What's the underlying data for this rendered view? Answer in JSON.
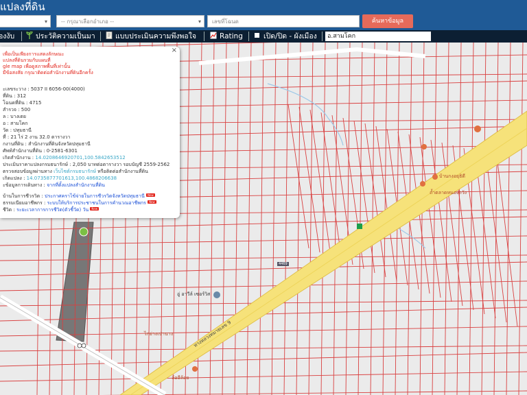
{
  "header": {
    "title": "แปลงที่ดิน",
    "select_district": "",
    "select_subdistrict_placeholder": "-- กรุณาเลือกอำเภอ --",
    "parcel_input_placeholder": "เลขที่โฉนด",
    "search_button": "ค้นหาข้อมูล"
  },
  "toolbar": {
    "items": [
      "องงับ",
      "ประวัติความเป็นมา",
      "แบบประเมินความพึงพอใจ",
      "Rating",
      "เปิด/ปิด - ผังเมือง"
    ],
    "location_value": "อ.สามโคก"
  },
  "popup": {
    "notice_lines": [
      "เพื่อเป็นเพียงการแสดงลักษณะ",
      "แปลงที่ดินรวมกับแผนที่",
      "gle map เพื่อดูสภาพพื้นที่เท่านั้น",
      "มีข้อสงสัย กรุณาติดต่อสำนักงานที่ดินอีกครั้ง"
    ],
    "fields": [
      "ะเลขระวาง : 5037 II 6056-00(4000)",
      "ที่ดิน : 312",
      "โฉนดที่ดิน : 4715",
      "สำรวจ : 500",
      "ล : บางเตย",
      "อ : สามโคก",
      "วัด : ปทุมธานี",
      "ที่ : 21 ไร่ 2 งาน 32.0 ตารางวา",
      "กงานที่ดิน : สำนักงานที่ดินจังหวัดปทุมธานี",
      "ศัพท์สำนักงานที่ดิน : 0-2581-6301"
    ],
    "office_location_label": "เกิดสำนักงาน : ",
    "office_location_value": "14.0208646920701,100.5842653512",
    "appraisal_line_1": "ประเมินราคาแปลงกรมธนารักษ์ : 2,050 บาทต่อตารางวา รอบบัญชี 2559-2562",
    "appraisal_line_2_prefix": "ตรวจสอบข้อมูลผ่านทาง ",
    "appraisal_line_2_link": "เว็บไซต์กรมธนารักษ์",
    "appraisal_line_2_suffix": " หรือติดต่อสำนักงานที่ดิน",
    "parcel_location_label": "เกิดแปลง : ",
    "parcel_location_value": "14.0735877701613,100.4868206638",
    "route_label": "ะข้อมูลการเดินทาง : ",
    "route_link": "จากที่ตั้งแปลงสำนักงานที่ดิน",
    "service_lines": [
      {
        "label": "บ้านในการชีวรวิต : ",
        "link": "ประกาศคราไข้จ่ายในการชีวรวิตจังหวัดปทุมธานี",
        "badge": "New"
      },
      {
        "label": "ธรรมเนียมอาชีพกร : ",
        "link": "ระบบให้บริการประชาชนในการคำนวณอาชีพกร",
        "badge": "New"
      },
      {
        "label": "ชีวิต : ",
        "link": "ระยะเวลาการการชีวิต(ตัวชี้วัด) วัน",
        "badge": "New"
      }
    ]
  },
  "map_labels": {
    "road_number": "ทางหลวงหมายเลข 9",
    "road_badge": "4469",
    "poi_1": "อู่ อาวีล์ เซอร์วิส",
    "poi_2": "บ้านกงอยุธิดี",
    "poi_3": "ไก่ย่างเป่านาง",
    "poi_4": "ล้ออีล้อย",
    "poi_5": "ถ้ำตลาดหนองถวัง"
  },
  "colors": {
    "header_bg": "#1f5a96",
    "toolbar_bg": "#0c1f33",
    "search_button": "#e66a5a",
    "parcel_line": "#d94040",
    "road_fill": "#f6e27a",
    "highlight_parcel": "#777777"
  }
}
